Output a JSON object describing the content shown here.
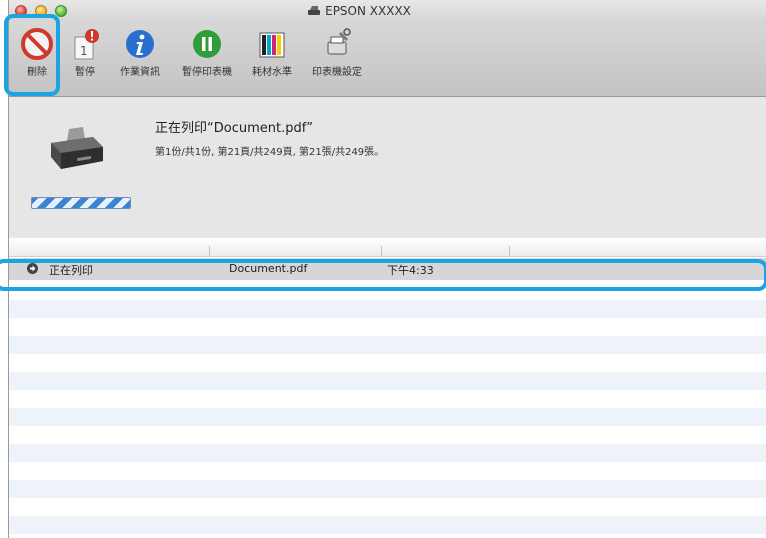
{
  "window": {
    "title": "EPSON XXXXX"
  },
  "toolbar": {
    "items": [
      {
        "label": "刪除",
        "icon": "delete-icon"
      },
      {
        "label": "暫停",
        "icon": "pause-job-icon"
      },
      {
        "label": "作業資訊",
        "icon": "info-icon"
      },
      {
        "label": "暫停印表機",
        "icon": "pause-printer-icon"
      },
      {
        "label": "耗材水準",
        "icon": "supply-levels-icon"
      },
      {
        "label": "印表機設定",
        "icon": "printer-settings-icon"
      }
    ]
  },
  "status": {
    "document_title": "正在列印“Document.pdf”",
    "progress_text": "第1份/共1份, 第21頁/共249頁, 第21張/共249張。"
  },
  "jobs": [
    {
      "status": "正在列印",
      "name": "Document.pdf",
      "time": "下午4:33"
    }
  ],
  "colors": {
    "highlight": "#1ba3e2",
    "accent_green": "#2f9e3a",
    "info_blue": "#2a6fcf",
    "delete_red": "#d1392f"
  }
}
